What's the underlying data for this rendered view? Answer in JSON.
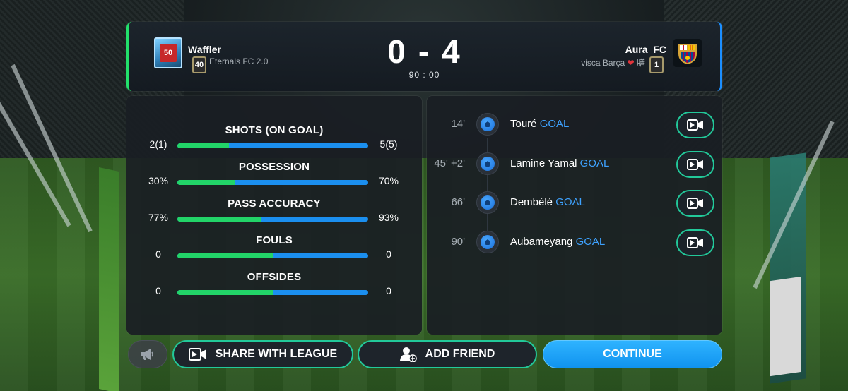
{
  "home": {
    "name": "Waffler",
    "club": "Eternals FC 2.0",
    "level": "40",
    "badge_text": "50"
  },
  "away": {
    "name": "Aura_FC",
    "club": "visca Barça",
    "club_suffix": "膳",
    "level": "1"
  },
  "score": {
    "home": "0",
    "dash": "-",
    "away": "4"
  },
  "clock": "90 : 00",
  "stats": [
    {
      "title": "SHOTS (ON GOAL)",
      "home": "2(1)",
      "away": "5(5)",
      "home_share": 0.27
    },
    {
      "title": "POSSESSION",
      "home": "30%",
      "away": "70%",
      "home_share": 0.3
    },
    {
      "title": "PASS ACCURACY",
      "home": "77%",
      "away": "93%",
      "home_share": 0.44
    },
    {
      "title": "FOULS",
      "home": "0",
      "away": "0",
      "home_share": 0.5
    },
    {
      "title": "OFFSIDES",
      "home": "0",
      "away": "0",
      "home_share": 0.5
    }
  ],
  "events": [
    {
      "minute": "14'",
      "player": "Touré",
      "type": "GOAL"
    },
    {
      "minute": "45' +2'",
      "player": "Lamine Yamal",
      "type": "GOAL"
    },
    {
      "minute": "66'",
      "player": "Dembélé",
      "type": "GOAL"
    },
    {
      "minute": "90'",
      "player": "Aubameyang",
      "type": "GOAL"
    }
  ],
  "buttons": {
    "share": "SHARE WITH LEAGUE",
    "add_friend": "ADD FRIEND",
    "continue": "CONTINUE"
  },
  "colors": {
    "home_accent": "#22d468",
    "away_accent": "#1b8fef",
    "goal_text": "#3ea2ff",
    "button_border": "#22c99a",
    "continue_bg": "#1ea3f5"
  },
  "icons": {
    "megaphone": "megaphone-icon",
    "share": "video-camera-icon",
    "add_friend": "add-user-icon",
    "event": "soccer-ball-icon",
    "replay": "video-camera-icon"
  }
}
